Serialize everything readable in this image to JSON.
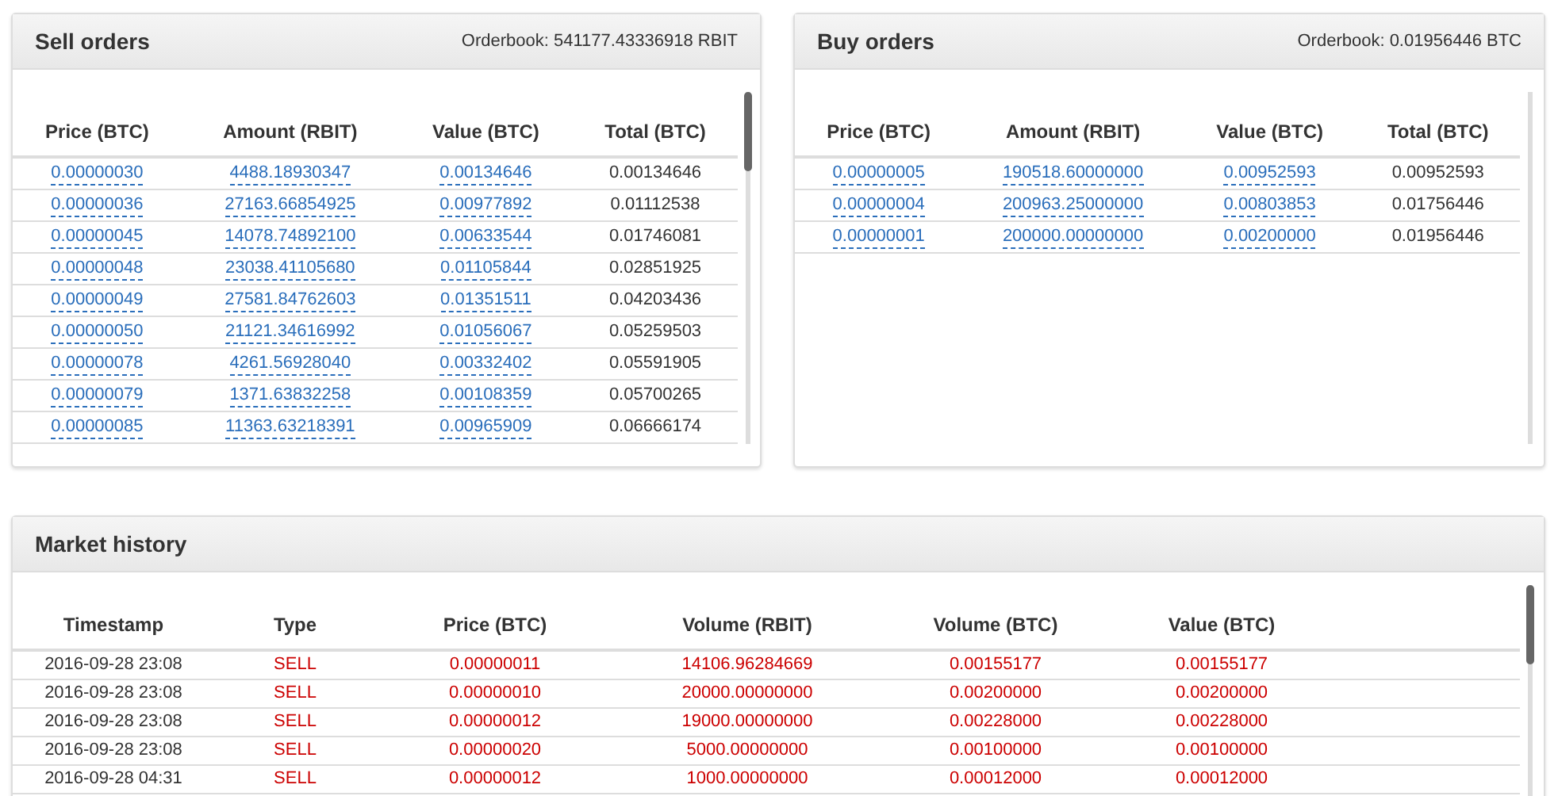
{
  "sell_orders": {
    "title": "Sell orders",
    "orderbook": "Orderbook: 541177.43336918 RBIT",
    "columns": [
      "Price (BTC)",
      "Amount (RBIT)",
      "Value (BTC)",
      "Total (BTC)"
    ],
    "rows": [
      [
        "0.00000030",
        "4488.18930347",
        "0.00134646",
        "0.00134646"
      ],
      [
        "0.00000036",
        "27163.66854925",
        "0.00977892",
        "0.01112538"
      ],
      [
        "0.00000045",
        "14078.74892100",
        "0.00633544",
        "0.01746081"
      ],
      [
        "0.00000048",
        "23038.41105680",
        "0.01105844",
        "0.02851925"
      ],
      [
        "0.00000049",
        "27581.84762603",
        "0.01351511",
        "0.04203436"
      ],
      [
        "0.00000050",
        "21121.34616992",
        "0.01056067",
        "0.05259503"
      ],
      [
        "0.00000078",
        "4261.56928040",
        "0.00332402",
        "0.05591905"
      ],
      [
        "0.00000079",
        "1371.63832258",
        "0.00108359",
        "0.05700265"
      ],
      [
        "0.00000085",
        "11363.63218391",
        "0.00965909",
        "0.06666174"
      ]
    ]
  },
  "buy_orders": {
    "title": "Buy orders",
    "orderbook": "Orderbook: 0.01956446 BTC",
    "columns": [
      "Price (BTC)",
      "Amount (RBIT)",
      "Value (BTC)",
      "Total (BTC)"
    ],
    "rows": [
      [
        "0.00000005",
        "190518.60000000",
        "0.00952593",
        "0.00952593"
      ],
      [
        "0.00000004",
        "200963.25000000",
        "0.00803853",
        "0.01756446"
      ],
      [
        "0.00000001",
        "200000.00000000",
        "0.00200000",
        "0.01956446"
      ]
    ]
  },
  "market_history": {
    "title": "Market history",
    "columns": [
      "Timestamp",
      "Type",
      "Price (BTC)",
      "Volume (RBIT)",
      "Volume (BTC)",
      "Value (BTC)"
    ],
    "rows": [
      {
        "kind": "sell",
        "cells": [
          "2016-09-28 23:08",
          "SELL",
          "0.00000011",
          "14106.96284669",
          "0.00155177",
          "0.00155177"
        ]
      },
      {
        "kind": "sell",
        "cells": [
          "2016-09-28 23:08",
          "SELL",
          "0.00000010",
          "20000.00000000",
          "0.00200000",
          "0.00200000"
        ]
      },
      {
        "kind": "sell",
        "cells": [
          "2016-09-28 23:08",
          "SELL",
          "0.00000012",
          "19000.00000000",
          "0.00228000",
          "0.00228000"
        ]
      },
      {
        "kind": "sell",
        "cells": [
          "2016-09-28 23:08",
          "SELL",
          "0.00000020",
          "5000.00000000",
          "0.00100000",
          "0.00100000"
        ]
      },
      {
        "kind": "sell",
        "cells": [
          "2016-09-28 04:31",
          "SELL",
          "0.00000012",
          "1000.00000000",
          "0.00012000",
          "0.00012000"
        ]
      }
    ]
  }
}
